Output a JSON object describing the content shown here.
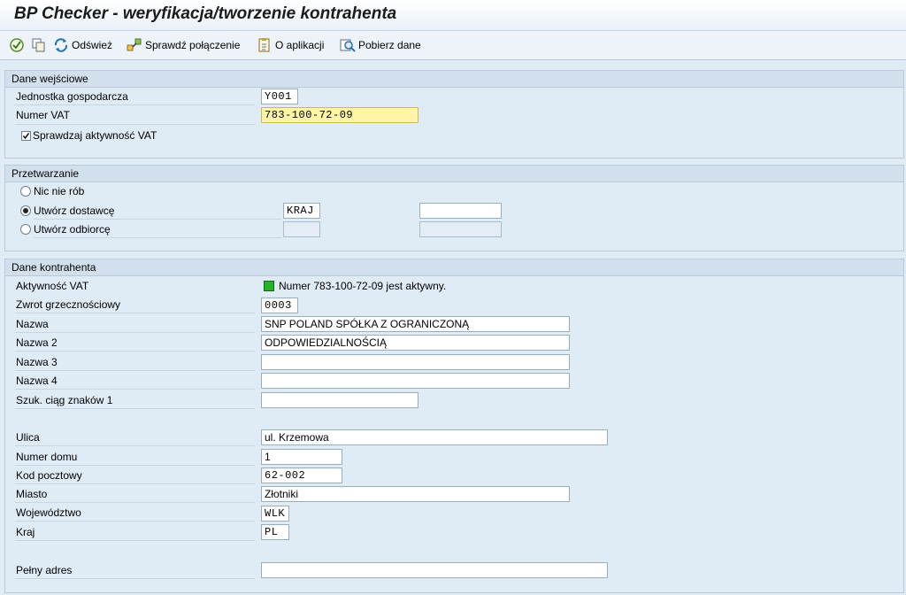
{
  "window": {
    "title": "BP Checker - weryfikacja/tworzenie kontrahenta"
  },
  "toolbar": {
    "execute_icon": "execute-icon",
    "copy_icon": "copy-icon",
    "refresh_label": "Odśwież",
    "check_connection_label": "Sprawdź połączenie",
    "about_label": "O aplikacji",
    "fetch_label": "Pobierz dane"
  },
  "input_section": {
    "title": "Dane wejściowe",
    "company_code_label": "Jednostka gospodarcza",
    "company_code_value": "Y001",
    "vat_label": "Numer VAT",
    "vat_value": "783-100-72-09",
    "check_vat_label": "Sprawdzaj aktywność VAT",
    "check_vat_checked": true
  },
  "processing_section": {
    "title": "Przetwarzanie",
    "options": [
      {
        "label": "Nic nie rób",
        "selected": false
      },
      {
        "label": "Utwórz dostawcę",
        "selected": true
      },
      {
        "label": "Utwórz odbiorcę",
        "selected": false
      }
    ],
    "supplier_group_value": "KRAJ"
  },
  "partner_section": {
    "title": "Dane kontrahenta",
    "vat_activity_label": "Aktywność VAT",
    "vat_activity_text": "Numer 783-100-72-09 jest aktywny.",
    "status_color": "#22b422",
    "salutation_label": "Zwrot grzecznościowy",
    "salutation_value": "0003",
    "name_label": "Nazwa",
    "name_value": "SNP POLAND SPÓŁKA Z OGRANICZONĄ",
    "name2_label": "Nazwa 2",
    "name2_value": "ODPOWIEDZIALNOŚCIĄ",
    "name3_label": "Nazwa 3",
    "name3_value": "",
    "name4_label": "Nazwa 4",
    "name4_value": "",
    "search_term_label": "Szuk. ciąg znaków 1",
    "search_term_value": "",
    "street_label": "Ulica",
    "street_value": "ul. Krzemowa",
    "house_no_label": "Numer domu",
    "house_no_value": "1",
    "postal_code_label": "Kod pocztowy",
    "postal_code_value": "62-002",
    "city_label": "Miasto",
    "city_value": "Złotniki",
    "region_label": "Województwo",
    "region_value": "WLK",
    "country_label": "Kraj",
    "country_value": "PL",
    "full_address_label": "Pełny adres",
    "full_address_value": ""
  }
}
